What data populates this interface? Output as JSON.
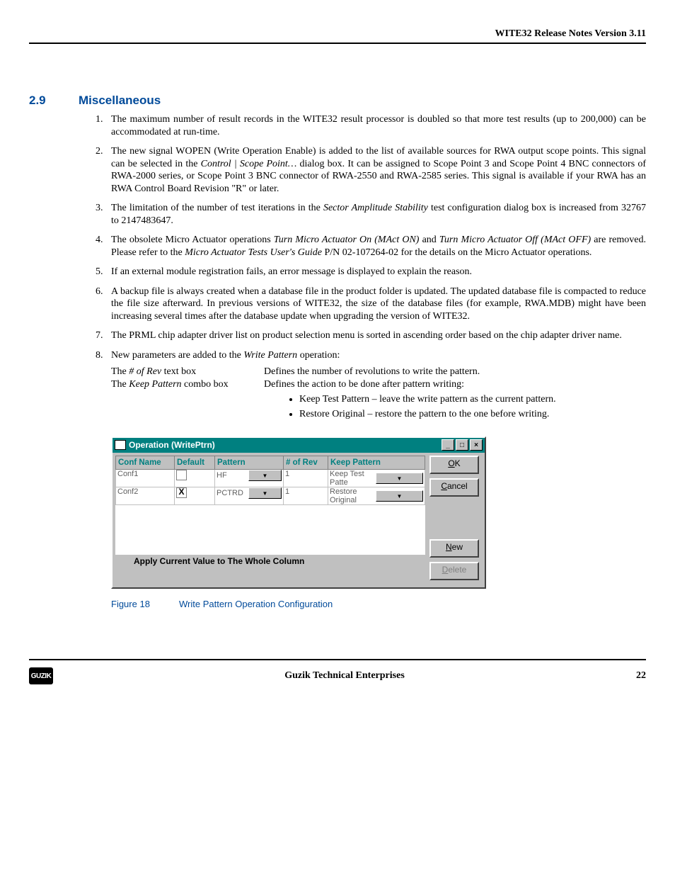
{
  "header": {
    "title": "WITE32 Release Notes Version 3.11"
  },
  "section": {
    "num": "2.9",
    "title": "Miscellaneous"
  },
  "list": {
    "i1": "The maximum number of result records in the WITE32 result processor is doubled so that more test results (up to 200,000) can be accommodated at run-time.",
    "i2a": "The new signal WOPEN (Write Operation Enable) is added to the list of available sources for RWA output scope points. This signal can be selected in the ",
    "i2b": "Control | Scope Point…",
    "i2c": " dialog box. It can be assigned to Scope Point 3 and Scope Point 4 BNC connectors of RWA-2000 series, or Scope Point 3 BNC connector of RWA-2550 and RWA-2585 series. This signal is available if your RWA has an RWA Control Board Revision \"R\" or later.",
    "i3a": "The limitation of the number of test iterations in the ",
    "i3b": "Sector Amplitude Stability",
    "i3c": " test configuration dialog box is increased from 32767 to 2147483647.",
    "i4a": "The obsolete Micro Actuator operations ",
    "i4b": "Turn Micro Actuator On (MAct ON)",
    "i4c": " and ",
    "i4d": "Turn Micro Actuator Off (MAct OFF)",
    "i4e": " are removed. Please refer to the ",
    "i4f": "Micro Actuator Tests User's Guide",
    "i4g": " P/N 02-107264-02 for the details on the Micro Actuator operations.",
    "i5": "If an external module registration fails, an error message is displayed to explain the reason.",
    "i6": "A backup file is always created when a database file in the product folder is updated.  The updated database file is compacted to reduce the file size afterward. In previous versions of WITE32, the size of the database files (for example, RWA.MDB) might have been increasing several times after the database update when upgrading the version of WITE32.",
    "i7": "The PRML chip adapter driver list on product selection menu is sorted in ascending order based on the chip adapter driver name.",
    "i8a": "New parameters are added to the ",
    "i8b": "Write Pattern",
    "i8c": " operation:"
  },
  "params": {
    "p1name_a": "The ",
    "p1name_b": "# of Rev",
    "p1name_c": " text box",
    "p1val": "Defines the number of revolutions to write the pattern.",
    "p2name_a": "The ",
    "p2name_b": "Keep Pattern",
    "p2name_c": " combo box",
    "p2val": "Defines the action to be done after pattern writing:",
    "p2b1": "Keep Test Pattern – leave the write pattern as the current pattern.",
    "p2b2": "Restore Original – restore the pattern to the one before writing."
  },
  "dialog": {
    "title": "Operation (WritePtrn)",
    "headers": {
      "c1": "Conf Name",
      "c2": "Default",
      "c3": "Pattern",
      "c4": "# of Rev",
      "c5": "Keep Pattern"
    },
    "rows": [
      {
        "name": "Conf1",
        "default": "",
        "pattern": "HF",
        "rev": "1",
        "keep": "Keep Test Patte"
      },
      {
        "name": "Conf2",
        "default": "X",
        "pattern": "PCTRD",
        "rev": "1",
        "keep": "Restore Original"
      }
    ],
    "buttons": {
      "ok": "OK",
      "cancel": "Cancel",
      "new": "New",
      "delete": "Delete"
    },
    "apply": "Apply Current Value to The Whole Column"
  },
  "figure": {
    "num": "Figure 18",
    "cap": "Write Pattern Operation Configuration"
  },
  "footer": {
    "logo": "GUZIK",
    "company": "Guzik Technical Enterprises",
    "page": "22"
  }
}
